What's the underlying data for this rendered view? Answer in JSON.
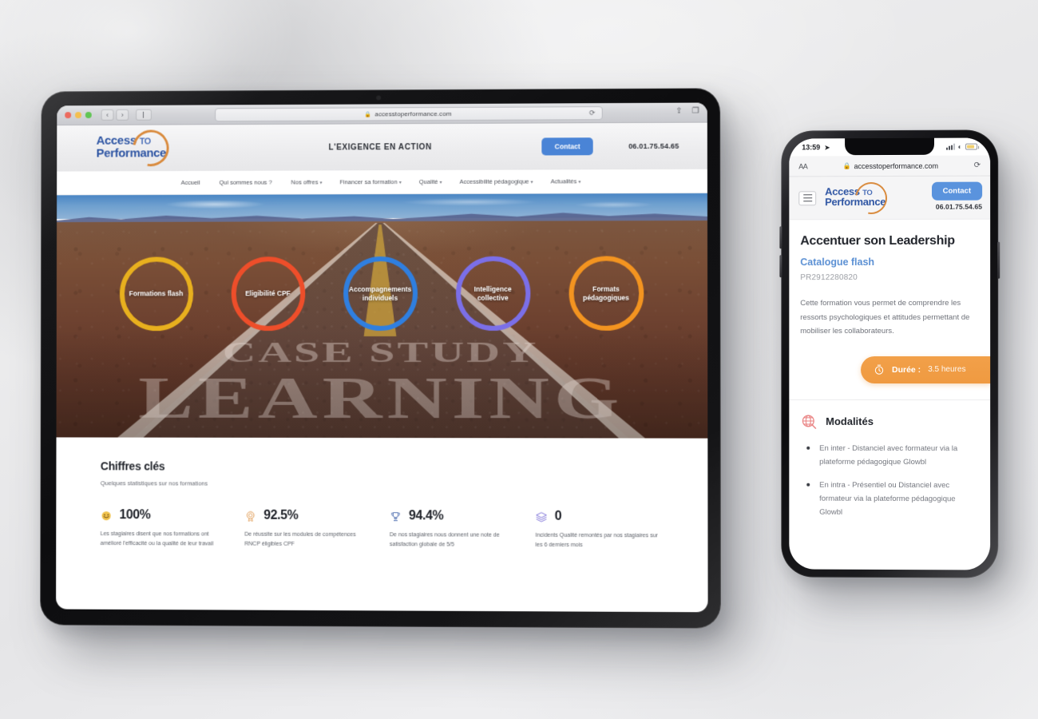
{
  "tablet": {
    "browser": {
      "url": "accesstoperformance.com",
      "lock_icon": "lock-icon",
      "reload_icon": "reload-icon",
      "back_icon": "‹",
      "forward_icon": "›",
      "share_icon": "⇪",
      "tabs_icon": "❐"
    },
    "site": {
      "logo": {
        "line1": "Access",
        "to": "TO",
        "line2": "Performance"
      },
      "tagline": "L'EXIGENCE EN ACTION",
      "contact_label": "Contact",
      "phone": "06.01.75.54.65",
      "nav": [
        {
          "label": "Accueil",
          "caret": ""
        },
        {
          "label": "Qui sommes nous ?",
          "caret": ""
        },
        {
          "label": "Nos offres",
          "caret": "▾"
        },
        {
          "label": "Financer sa formation",
          "caret": "▾"
        },
        {
          "label": "Qualité",
          "caret": "▾"
        },
        {
          "label": "Accessibilité pédagogique",
          "caret": "▾"
        },
        {
          "label": "Actualités",
          "caret": "▾"
        }
      ],
      "hero": {
        "road_text_1": "CASE STUDY",
        "road_text_2": "LEARNING",
        "circles": [
          {
            "label": "Formations flash",
            "color": "#e8b01e"
          },
          {
            "label": "Eligibilité CPF",
            "color": "#ee4e2a"
          },
          {
            "label": "Accompagnements individuels",
            "color": "#2f7fe0"
          },
          {
            "label": "Intelligence collective",
            "color": "#7b6fe8"
          },
          {
            "label": "Formats pédagogiques",
            "color": "#f39420"
          }
        ]
      },
      "stats": {
        "title": "Chiffres clés",
        "subtitle": "Quelques statistiques sur nos formations",
        "items": [
          {
            "icon": "smiley-icon",
            "value": "100%",
            "desc": "Les stagiaires disent que nos formations ont amélioré l'efficacité ou la qualité de leur travail"
          },
          {
            "icon": "certificate-icon",
            "value": "92.5%",
            "desc": "De réussite sur les modules de compétences RNCP éligibles CPF"
          },
          {
            "icon": "trophy-icon",
            "value": "94.4%",
            "desc": "De nos stagiaires nous donnent une note de satisfaction globale de 5/5"
          },
          {
            "icon": "layers-icon",
            "value": "0",
            "desc": "Incidents Qualité remontés par nos stagiaires sur les 6 derniers mois"
          }
        ]
      }
    }
  },
  "phone": {
    "status": {
      "time": "13:59",
      "location_icon": "location-arrow-icon",
      "signal_icon": "signal-icon",
      "wifi_icon": "wifi-icon",
      "battery_icon": "battery-icon"
    },
    "browser": {
      "text_size_label": "AA",
      "lock_icon": "lock-icon",
      "url": "accesstoperformance.com",
      "reload_icon": "reload-icon"
    },
    "header": {
      "menu_icon": "hamburger-menu-icon",
      "logo": {
        "line1": "Access",
        "to": "TO",
        "line2": "Performance"
      },
      "contact_label": "Contact",
      "phone": "06.01.75.54.65"
    },
    "content": {
      "title": "Accentuer son Leadership",
      "category": "Catalogue flash",
      "reference": "PR2912280820",
      "description": "Cette formation vous permet de comprendre les ressorts psychologiques et attitudes permettant de mobiliser les collaborateurs.",
      "duration_badge": {
        "icon": "timer-icon",
        "label": "Durée :",
        "value": "3.5 heures"
      },
      "modalites": {
        "icon": "globe-icon",
        "title": "Modalités",
        "items": [
          "En inter - Distanciel avec formateur via la plateforme pédagogique Glowbl",
          "En intra - Présentiel ou Distanciel avec formateur via la plateforme pédagogique Glowbl"
        ]
      }
    }
  }
}
